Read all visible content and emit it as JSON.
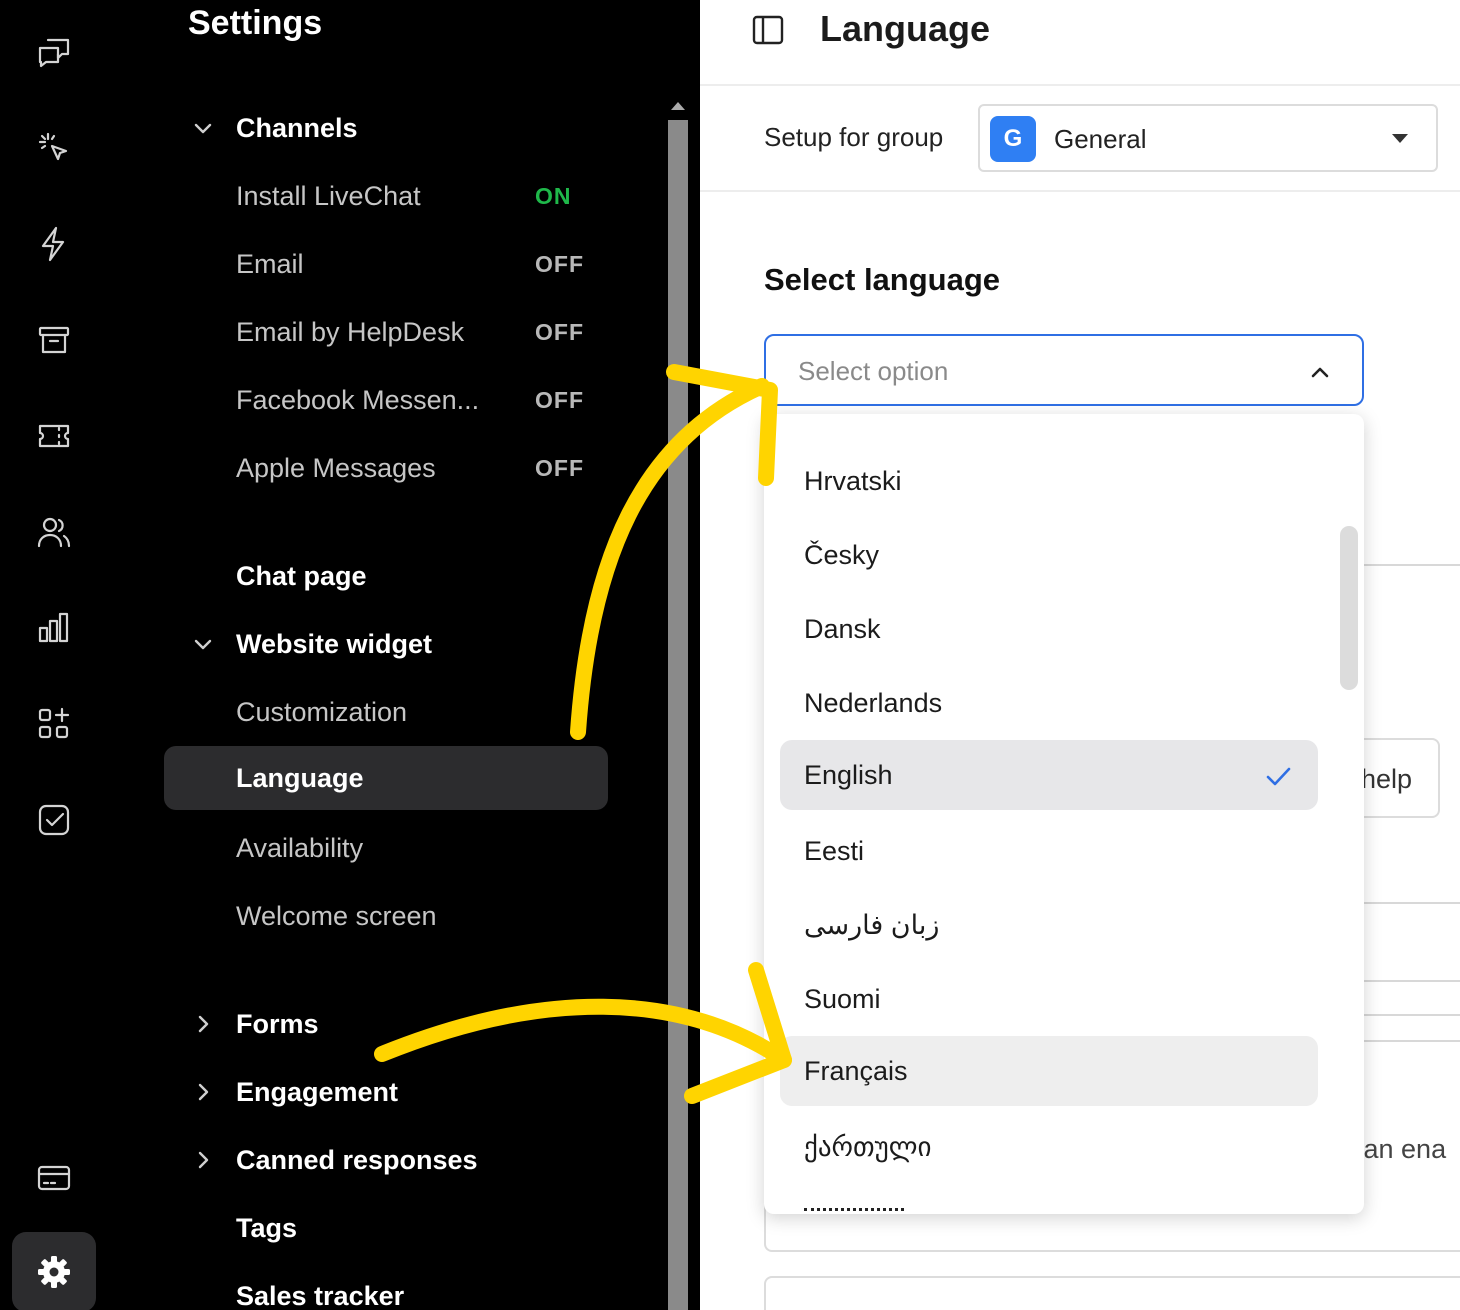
{
  "rail": {
    "icons": [
      "chats-icon",
      "click-icon",
      "lightning-icon",
      "archive-icon",
      "ticket-icon",
      "team-icon",
      "reports-icon",
      "apps-icon",
      "checklist-icon",
      "billing-icon"
    ],
    "active_icon": "gear-icon"
  },
  "sidebar": {
    "title": "Settings",
    "channels": {
      "label": "Channels",
      "items": [
        {
          "label": "Install LiveChat",
          "status": "ON"
        },
        {
          "label": "Email",
          "status": "OFF"
        },
        {
          "label": "Email by HelpDesk",
          "status": "OFF"
        },
        {
          "label": "Facebook Messen...",
          "status": "OFF"
        },
        {
          "label": "Apple Messages",
          "status": "OFF"
        }
      ]
    },
    "chat_page": "Chat page",
    "website_widget": {
      "label": "Website widget",
      "items": [
        "Customization",
        "Language",
        "Availability",
        "Welcome screen"
      ]
    },
    "forms": "Forms",
    "engagement": "Engagement",
    "canned_responses": "Canned responses",
    "tags": "Tags",
    "sales_tracker": "Sales tracker"
  },
  "main": {
    "title": "Language",
    "group_label": "Setup for group",
    "group_badge": "G",
    "group_value": "General",
    "section_title": "Select language",
    "select_placeholder": "Select option",
    "help_text": "help",
    "enable_text": "can ena",
    "options": [
      "Hrvatski",
      "Česky",
      "Dansk",
      "Nederlands",
      "English",
      "Eesti",
      "زبان فارسی",
      "Suomi",
      "Français",
      "ქართული"
    ],
    "selected_option": "English",
    "hovered_option": "Français"
  },
  "colors": {
    "accent": "#2f6fe4",
    "on_status": "#1fb84a",
    "annotation": "#ffd400"
  }
}
